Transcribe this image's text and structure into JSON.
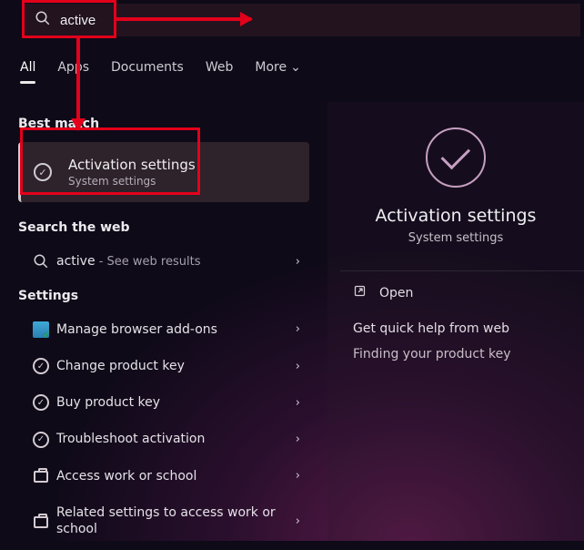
{
  "search": {
    "value": "active"
  },
  "tabs": {
    "all": "All",
    "apps": "Apps",
    "documents": "Documents",
    "web": "Web",
    "more": "More"
  },
  "groups": {
    "best_match": "Best match",
    "search_web": "Search the web",
    "settings": "Settings"
  },
  "best_match": {
    "title": "Activation settings",
    "subtitle": "System settings"
  },
  "web_result": {
    "term": "active",
    "suffix": " - See web results"
  },
  "settings_items": [
    {
      "label": "Manage browser add-ons",
      "icon": "addon"
    },
    {
      "label": "Change product key",
      "icon": "check"
    },
    {
      "label": "Buy product key",
      "icon": "check"
    },
    {
      "label": "Troubleshoot activation",
      "icon": "check"
    },
    {
      "label": "Access work or school",
      "icon": "briefcase"
    },
    {
      "label": "Related settings to access work or school",
      "icon": "briefcase"
    }
  ],
  "right": {
    "title": "Activation settings",
    "subtitle": "System settings",
    "open": "Open",
    "help_header": "Get quick help from web",
    "help_link": "Finding your product key"
  }
}
